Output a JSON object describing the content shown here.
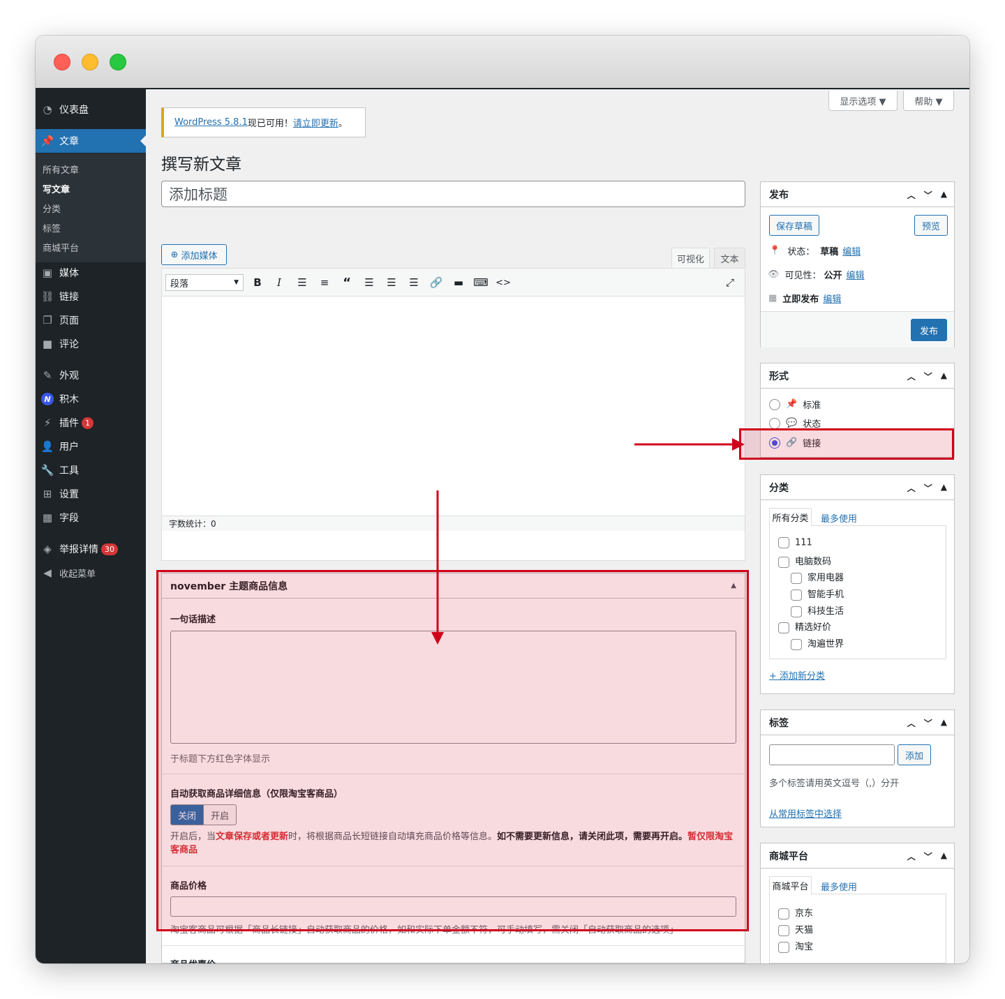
{
  "sidebar": {
    "items": [
      {
        "label": "仪表盘",
        "icon": "dashboard-icon"
      },
      {
        "label": "文章",
        "icon": "pin-icon"
      },
      {
        "label": "媒体",
        "icon": "media-icon"
      },
      {
        "label": "链接",
        "icon": "link-icon"
      },
      {
        "label": "页面",
        "icon": "page-icon"
      },
      {
        "label": "评论",
        "icon": "comment-icon"
      },
      {
        "label": "外观",
        "icon": "appearance-icon"
      },
      {
        "label": "积木",
        "icon": "blocks-icon"
      },
      {
        "label": "插件",
        "icon": "plugin-icon",
        "badge": "1"
      },
      {
        "label": "用户",
        "icon": "user-icon"
      },
      {
        "label": "工具",
        "icon": "wrench-icon"
      },
      {
        "label": "设置",
        "icon": "settings-icon"
      },
      {
        "label": "字段",
        "icon": "fields-icon"
      },
      {
        "label": "举报详情",
        "icon": "tag-icon",
        "badge": "30"
      },
      {
        "label": "收起菜单",
        "icon": "collapse-icon"
      }
    ],
    "submenu": [
      "所有文章",
      "写文章",
      "分类",
      "标签",
      "商城平台"
    ]
  },
  "screen": {
    "options": "显示选项 ▼",
    "help": "帮助 ▼"
  },
  "notice": {
    "link1": "WordPress 5.8.1",
    "text": "现已可用！",
    "link2": "请立即更新",
    "end": "。"
  },
  "page_title": "撰写新文章",
  "title_placeholder": "添加标题",
  "editor": {
    "add_media": "添加媒体",
    "tab_visual": "可视化",
    "tab_text": "文本",
    "format_select": "段落",
    "word_count": "字数统计：0"
  },
  "meta_box": {
    "title": "november 主题商品信息",
    "desc_label": "一句话描述",
    "desc_hint": "于标题下方红色字体显示",
    "auto_label": "自动获取商品详细信息（仅限淘宝客商品）",
    "toggle_off": "关闭",
    "toggle_on": "开启",
    "auto_note_1": "开启后，当",
    "auto_note_red1": "文章保存或者更新",
    "auto_note_2": "时，将根据商品长短链接自动填充商品价格等信息。",
    "auto_note_bold": "如不需要更新信息，请关闭此项，需要再开启。",
    "auto_note_red2a": "暂仅限淘宝",
    "auto_note_red2b": "客商品",
    "price_label": "商品价格",
    "price_note": "淘宝客商品可根据「商品长链接」自动获取商品的价格，如和实际下单金额不符，可手动填写，需关闭「自动获取商品的选项」",
    "next_label": "商品优惠价"
  },
  "publish": {
    "title": "发布",
    "save_draft": "保存草稿",
    "preview": "预览",
    "status_label": "状态：",
    "status_value": "草稿",
    "visibility_label": "可见性：",
    "visibility_value": "公开",
    "schedule_label": "立即发布",
    "edit": "编辑",
    "publish_btn": "发布"
  },
  "format": {
    "title": "形式",
    "options": [
      {
        "label": "标准",
        "icon": "pin-icon",
        "checked": false
      },
      {
        "label": "状态",
        "icon": "chat-icon",
        "checked": false
      },
      {
        "label": "链接",
        "icon": "link-icon",
        "checked": true
      }
    ]
  },
  "categories": {
    "title": "分类",
    "tab_all": "所有分类",
    "tab_popular": "最多使用",
    "items": [
      {
        "label": "111",
        "level": 0
      },
      {
        "label": "电脑数码",
        "level": 0
      },
      {
        "label": "家用电器",
        "level": 1
      },
      {
        "label": "智能手机",
        "level": 1
      },
      {
        "label": "科技生活",
        "level": 1
      },
      {
        "label": "精选好价",
        "level": 0
      },
      {
        "label": "淘遍世界",
        "level": 1
      }
    ],
    "add_new": "+ 添加新分类"
  },
  "tags": {
    "title": "标签",
    "add_btn": "添加",
    "hint": "多个标签请用英文逗号（,）分开",
    "choose": "从常用标签中选择"
  },
  "mall": {
    "title": "商城平台",
    "tab_all": "商城平台",
    "tab_popular": "最多使用",
    "items": [
      "京东",
      "天猫",
      "淘宝"
    ]
  },
  "colors": {
    "accent": "#2271b1",
    "annotation": "#d0021b",
    "sidebar": "#1d2327"
  }
}
